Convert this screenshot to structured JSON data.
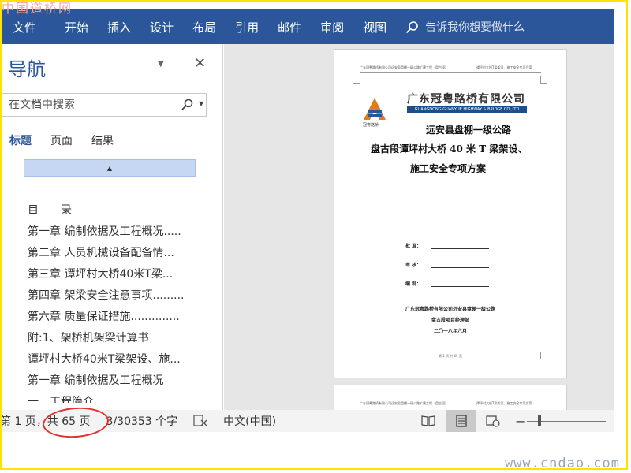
{
  "watermarks": {
    "top": "中国道桥网",
    "bottom": "www.cndao.com"
  },
  "ribbon": {
    "tabs": [
      "文件",
      "开始",
      "插入",
      "设计",
      "布局",
      "引用",
      "邮件",
      "审阅",
      "视图"
    ],
    "tell_me": "告诉我你想要做什么"
  },
  "nav": {
    "title": "导航",
    "search_placeholder": "在文档中搜索",
    "tabs": [
      "标题",
      "页面",
      "结果"
    ],
    "active_tab": "标题",
    "headings": [
      "目　　录",
      "第一章  编制依据及工程概况.....",
      "第二章  人员机械设备配备情...",
      "第三章  谭坪村大桥40米T梁...",
      "第四章  架梁安全注意事项.........",
      "第六章  质量保证措施..............",
      "附:1、架桥机架梁计算书",
      "谭坪村大桥40米T梁架设、施...",
      "第一章  编制依据及工程概况",
      "一、工程简介"
    ]
  },
  "document": {
    "header_left": "广东冠粤路桥有限公司远安县盘棚一级公路扩建工程（盘古段）",
    "header_right": "谭坪村大桥T梁架设、施工安全专项方案",
    "company_cn": "广东冠粤路桥有限公司",
    "company_en": "GUANGDONG GUANYUE HIGHWAY & BRIDGE CO.,LTD",
    "logo_text": "冠粤路桥",
    "title_line1": "远安县盘棚一级公路",
    "title_line2": "盘古段谭坪村大桥 40 米 T 梁架设、",
    "title_line3": "施工安全专项方案",
    "sig_labels": [
      "批  准：",
      "审  核：",
      "编  制："
    ],
    "footer_line1": "广东冠粤路桥有限公司远安县盘棚一级公路",
    "footer_line2": "盘古段项目经理部",
    "footer_date": "二〇一八年六月",
    "page_footer": "第 1 页 共 65 页"
  },
  "status": {
    "page_prefix": "第 1 页，",
    "page_total": "共 65 页",
    "word_count": "3/30353 个字",
    "language": "中文(中国)"
  },
  "colors": {
    "ribbon": "#2b579a",
    "accent": "#2b579a",
    "frame": "#ffe300",
    "highlight": "#e3302c"
  }
}
